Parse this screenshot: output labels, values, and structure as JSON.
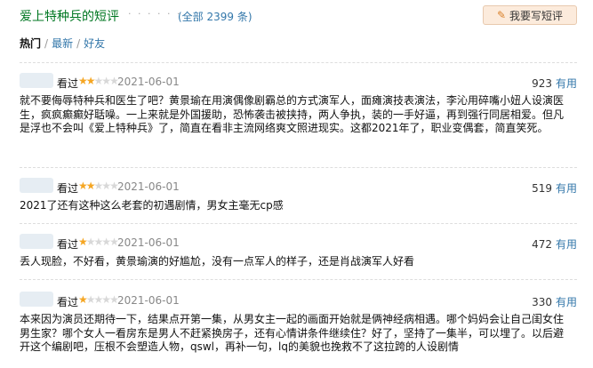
{
  "header": {
    "title": "爱上特种兵的短评",
    "dots": "· · · · · ·",
    "total": "(全部 2399 条)",
    "write_button": "我要写短评"
  },
  "sort": {
    "hot": "热门",
    "sep": "/",
    "latest": "最新",
    "friends": "好友"
  },
  "reviews": [
    {
      "seen": "看过",
      "rating": 2,
      "date": "2021-06-01",
      "votes": "923",
      "useful": "有用",
      "content": "就不要侮辱特种兵和医生了吧？黄景瑜在用演偶像剧霸总的方式演军人，面瘫演技表演法，李沁用碎嘴小妞人设演医生，疯疯癫癫好聒噪。一上来就是外国援助，恐怖袭击被挟持，两人争执，装的一手好逼，再到强行同居相爱。但凡是浮也不会叫《爱上特种兵》了，简直在看非主流网络爽文照进现实。这都2021年了，职业变偶套，简直笑死。"
    },
    {
      "seen": "看过",
      "rating": 2,
      "date": "2021-06-01",
      "votes": "519",
      "useful": "有用",
      "content": "2021了还有这种这么老套的初遇剧情，男女主毫无cp感"
    },
    {
      "seen": "看过",
      "rating": 1,
      "date": "2021-06-01",
      "votes": "472",
      "useful": "有用",
      "content": "丢人现脸，不好看，黄景瑜演的好尴尬，没有一点军人的样子，还是肖战演军人好看"
    },
    {
      "seen": "看过",
      "rating": 1,
      "date": "2021-06-01",
      "votes": "330",
      "useful": "有用",
      "content": "本来因为演员还期待一下，结果点开第一集，从男女主一起的画面开始就是俩神经病相遇。哪个妈妈会让自己闺女住男生家？哪个女人一看房东是男人不赶紧换房子，还有心情讲条件继续住？好了，坚持了一集半，可以埋了。以后避开这个编剧吧，压根不会塑造人物，qswl，再补一句，lq的美貌也挽救不了这拉跨的人设剧情"
    }
  ]
}
